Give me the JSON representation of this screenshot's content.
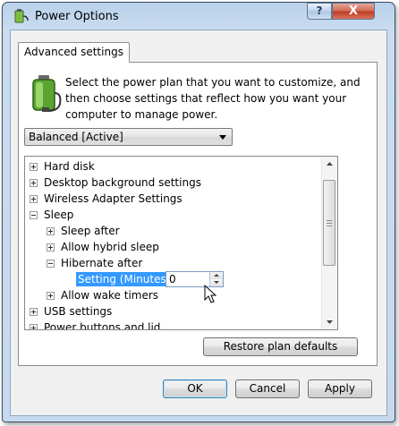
{
  "window": {
    "title": "Power Options",
    "help_label": "?",
    "close_label": "X"
  },
  "tab": {
    "label": "Advanced settings"
  },
  "intro": "Select the power plan that you want to customize, and then choose settings that reflect how you want your computer to manage power.",
  "plan_select": {
    "value": "Balanced [Active]"
  },
  "tree": [
    {
      "label": "Hard disk",
      "state": "collapsed"
    },
    {
      "label": "Desktop background settings",
      "state": "collapsed"
    },
    {
      "label": "Wireless Adapter Settings",
      "state": "collapsed"
    },
    {
      "label": "Sleep",
      "state": "expanded"
    },
    {
      "label": "Sleep after",
      "state": "collapsed"
    },
    {
      "label": "Allow hybrid sleep",
      "state": "collapsed"
    },
    {
      "label": "Hibernate after",
      "state": "expanded"
    },
    {
      "label": "Setting (Minutes):",
      "value": "0"
    },
    {
      "label": "Allow wake timers",
      "state": "collapsed"
    },
    {
      "label": "USB settings",
      "state": "collapsed"
    },
    {
      "label": "Power buttons and lid",
      "state": "collapsed"
    }
  ],
  "buttons": {
    "restore": "Restore plan defaults",
    "ok": "OK",
    "cancel": "Cancel",
    "apply": "Apply"
  }
}
